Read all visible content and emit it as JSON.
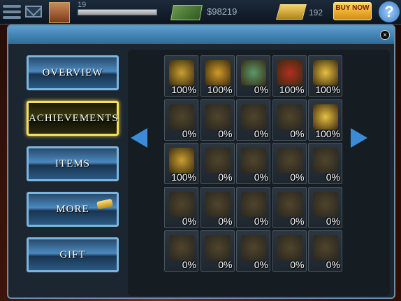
{
  "topbar": {
    "level": "19",
    "xp_fraction": 1.0,
    "cash": "$98219",
    "gold": "192",
    "buy_now_label": "BUY NOW"
  },
  "sidebar": {
    "items": [
      {
        "label": "OVERVIEW"
      },
      {
        "label": "ACHIEVEMENTS",
        "active": true
      },
      {
        "label": "ITEMS"
      },
      {
        "label": "MORE"
      },
      {
        "label": "GIFT"
      }
    ]
  },
  "achievements": [
    {
      "icon": "poker-hand-icon",
      "percent": "100%",
      "unlocked": true
    },
    {
      "icon": "bulldog-icon",
      "percent": "100%",
      "unlocked": true
    },
    {
      "icon": "chips-cards-icon",
      "percent": "0%",
      "unlocked": true
    },
    {
      "icon": "target-pig-icon",
      "percent": "100%",
      "unlocked": true
    },
    {
      "icon": "baby-icon",
      "percent": "100%",
      "unlocked": true
    },
    {
      "icon": "ace-spades-icon",
      "percent": "0%",
      "unlocked": false
    },
    {
      "icon": "boxing-gloves-icon",
      "percent": "0%",
      "unlocked": false
    },
    {
      "icon": "card-chips-icon",
      "percent": "0%",
      "unlocked": false
    },
    {
      "icon": "trophy-cards-icon",
      "percent": "0%",
      "unlocked": false
    },
    {
      "icon": "ace-trophy-icon",
      "percent": "100%",
      "unlocked": true
    },
    {
      "icon": "lucky-seven-icon",
      "percent": "100%",
      "unlocked": true
    },
    {
      "icon": "cat-icon",
      "percent": "0%",
      "unlocked": false
    },
    {
      "icon": "gramophone-icon",
      "percent": "0%",
      "unlocked": false
    },
    {
      "icon": "gangster-icon",
      "percent": "0%",
      "unlocked": false
    },
    {
      "icon": "card-fan-icon",
      "percent": "0%",
      "unlocked": false
    },
    {
      "icon": "crown-icon",
      "percent": "0%",
      "unlocked": false
    },
    {
      "icon": "buddha-icon",
      "percent": "0%",
      "unlocked": false
    },
    {
      "icon": "playing-cards-icon",
      "percent": "0%",
      "unlocked": false
    },
    {
      "icon": "sheriff-skull-icon",
      "percent": "0%",
      "unlocked": false
    },
    {
      "icon": "gold-bar-icon",
      "percent": "0%",
      "unlocked": false
    },
    {
      "icon": "silhouette-icon",
      "percent": "0%",
      "unlocked": false
    },
    {
      "icon": "card-trio-icon",
      "percent": "0%",
      "unlocked": false
    },
    {
      "icon": "royal-cards-icon",
      "percent": "0%",
      "unlocked": false
    },
    {
      "icon": "chips-stack-icon",
      "percent": "0%",
      "unlocked": false
    },
    {
      "icon": "cash-pile-icon",
      "percent": "0%",
      "unlocked": false
    }
  ],
  "colors": {
    "panel_header": "#2e6a98",
    "active_border": "#f6e05a",
    "button_border": "#7cb6e0",
    "arrow": "#3a8cd8"
  }
}
